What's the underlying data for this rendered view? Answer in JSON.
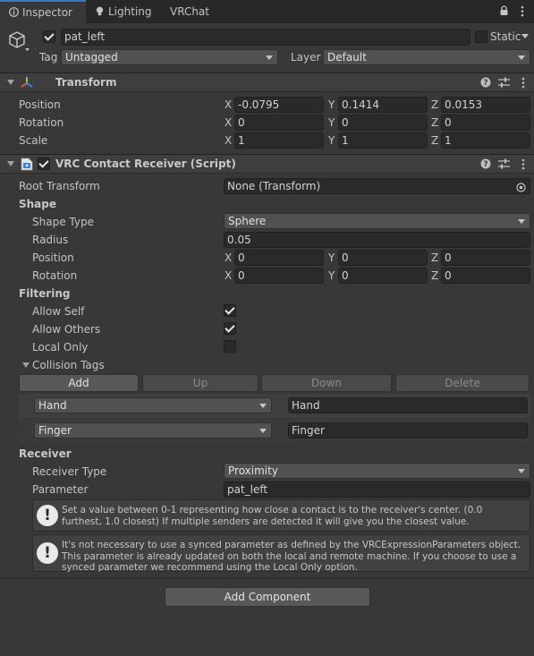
{
  "tabs": {
    "inspector": "Inspector",
    "lighting": "Lighting",
    "vrchat_sdk": "VRChat SDK",
    "menu_icons": "☰⋮"
  },
  "object": {
    "name": "pat_left",
    "active": true,
    "static_label": "Static",
    "tag_label": "Tag",
    "tag_value": "Untagged",
    "layer_label": "Layer",
    "layer_value": "Default"
  },
  "transform": {
    "title": "Transform",
    "rows": [
      {
        "label": "Position",
        "x": "-0.0795",
        "y": "0.1414",
        "z": "0.0153"
      },
      {
        "label": "Rotation",
        "x": "0",
        "y": "0",
        "z": "0"
      },
      {
        "label": "Scale",
        "x": "1",
        "y": "1",
        "z": "1"
      }
    ]
  },
  "axis": {
    "x": "X",
    "y": "Y",
    "z": "Z"
  },
  "contact": {
    "title": "VRC Contact Receiver (Script)",
    "enabled": true,
    "root_transform_label": "Root Transform",
    "root_transform_value": "None (Transform)",
    "shape_section": "Shape",
    "shape_type_label": "Shape Type",
    "shape_type_value": "Sphere",
    "radius_label": "Radius",
    "radius_value": "0.05",
    "position_label": "Position",
    "position": {
      "x": "0",
      "y": "0",
      "z": "0"
    },
    "rotation_label": "Rotation",
    "rotation": {
      "x": "0",
      "y": "0",
      "z": "0"
    },
    "filtering_section": "Filtering",
    "allow_self_label": "Allow Self",
    "allow_self": true,
    "allow_others_label": "Allow Others",
    "allow_others": true,
    "local_only_label": "Local Only",
    "local_only": false,
    "collision_tags_label": "Collision Tags",
    "buttons": {
      "add": "Add",
      "up": "Up",
      "down": "Down",
      "delete": "Delete"
    },
    "tags": [
      {
        "preset": "Hand",
        "value": "Hand"
      },
      {
        "preset": "Finger",
        "value": "Finger"
      }
    ],
    "receiver_section": "Receiver",
    "receiver_type_label": "Receiver Type",
    "receiver_type_value": "Proximity",
    "parameter_label": "Parameter",
    "parameter_value": "pat_left",
    "help1": "Set a value between 0-1 representing how close a contact is to the receiver's center. (0.0 furthest, 1.0 closest)  If multiple senders are detected it will give you the closest value.",
    "help2": "It's not necessary to use a synced parameter as defined by the VRCExpressionParameters object.  This parameter is already updated on both the local and remote machine.  If you choose to use a synced parameter we recommend using the Local Only option."
  },
  "add_component": "Add Component"
}
